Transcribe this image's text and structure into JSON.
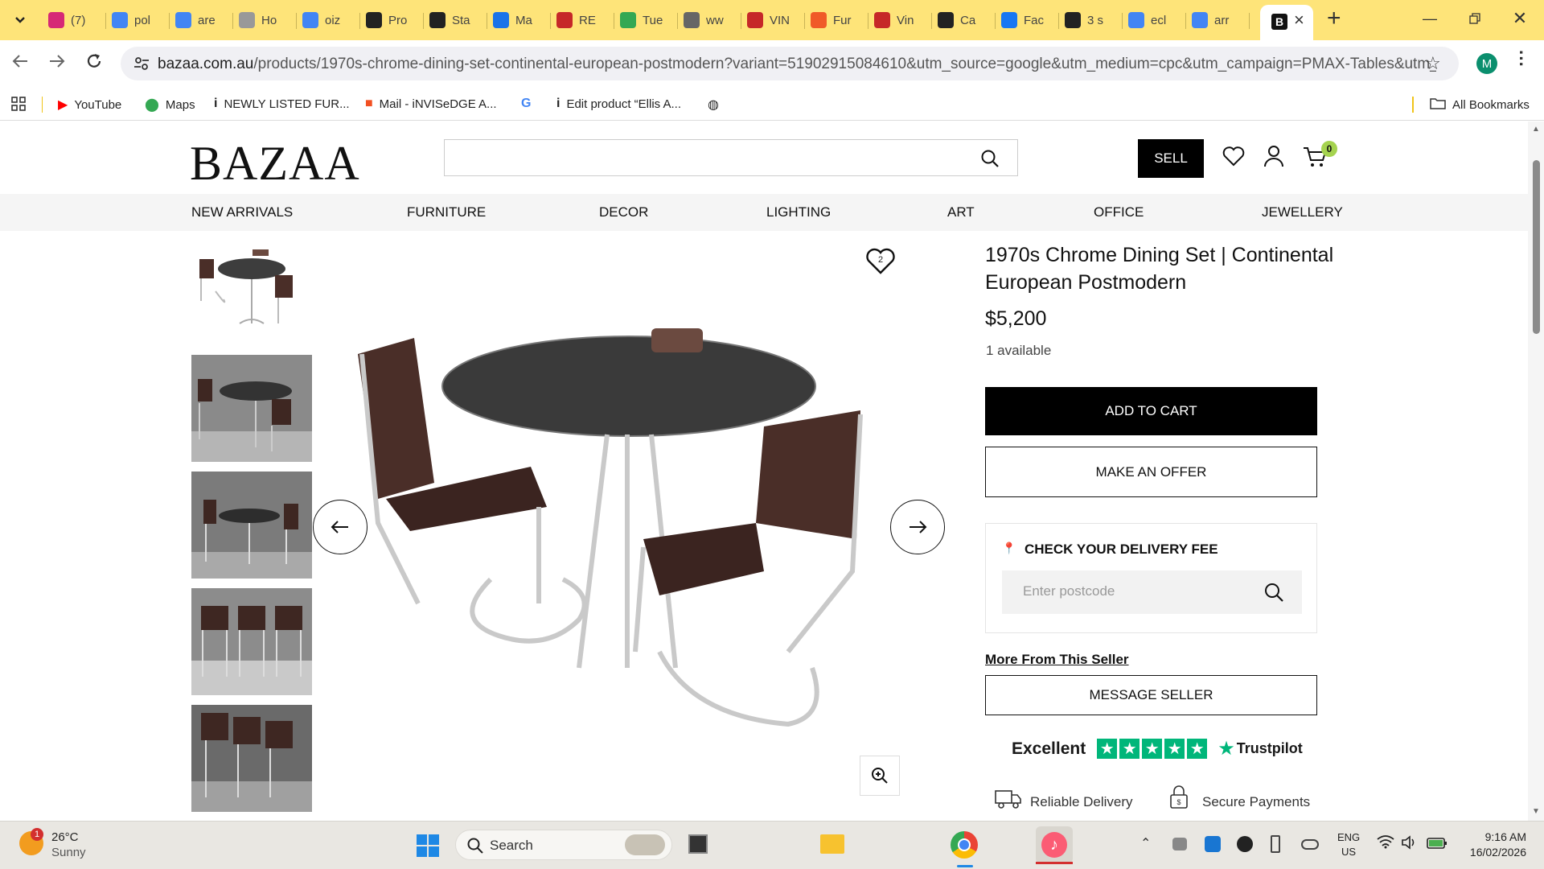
{
  "browser": {
    "tabs": [
      {
        "label": "(7)",
        "icon": "instagram-icon",
        "color": "#d62976"
      },
      {
        "label": "pol",
        "icon": "google-icon",
        "color": "#4285f4"
      },
      {
        "label": "are",
        "icon": "google-icon",
        "color": "#4285f4"
      },
      {
        "label": "Ho",
        "icon": "page-icon",
        "color": "#999999"
      },
      {
        "label": "oiz",
        "icon": "google-icon",
        "color": "#4285f4"
      },
      {
        "label": "Pro",
        "icon": "info-icon",
        "color": "#222222"
      },
      {
        "label": "Sta",
        "icon": "info-icon",
        "color": "#222222"
      },
      {
        "label": "Ma",
        "icon": "mail-icon",
        "color": "#1a73e8"
      },
      {
        "label": "RE",
        "icon": "store-icon",
        "color": "#c62828"
      },
      {
        "label": "Tue",
        "icon": "maps-icon",
        "color": "#34a853"
      },
      {
        "label": "ww",
        "icon": "globe-icon",
        "color": "#666666"
      },
      {
        "label": "VIN",
        "icon": "store-icon",
        "color": "#c62828"
      },
      {
        "label": "Fur",
        "icon": "arrow-icon",
        "color": "#f05a28"
      },
      {
        "label": "Vin",
        "icon": "store-icon",
        "color": "#c62828"
      },
      {
        "label": "Ca",
        "icon": "s-icon",
        "color": "#222222"
      },
      {
        "label": "Fac",
        "icon": "facebook-icon",
        "color": "#1877f2"
      },
      {
        "label": "3 s",
        "icon": "info-icon",
        "color": "#222222"
      },
      {
        "label": "ecl",
        "icon": "google-icon",
        "color": "#4285f4"
      },
      {
        "label": "arr",
        "icon": "google-icon",
        "color": "#4285f4"
      }
    ],
    "active_tab_icon": "B",
    "url_domain": "bazaa.com.au",
    "url_path": "/products/1970s-chrome-dining-set-continental-european-postmodern?variant=51902915084610&utm_source=google&utm_medium=cpc&utm_campaign=PMAX-Tables&utm_content...",
    "profile_initial": "M",
    "bookmarks": [
      {
        "label": "YouTube",
        "icon": "youtube-icon"
      },
      {
        "label": "Maps",
        "icon": "maps-pin-icon"
      },
      {
        "label": "NEWLY LISTED FUR...",
        "icon": "info-icon"
      },
      {
        "label": "Mail - iNVISeDGE A...",
        "icon": "microsoft-icon"
      },
      {
        "label": "",
        "icon": "google-icon"
      },
      {
        "label": "Edit product “Ellis A...",
        "icon": "info-icon"
      },
      {
        "label": "",
        "icon": "globe-icon"
      }
    ],
    "all_bookmarks": "All Bookmarks"
  },
  "site": {
    "logo": "BAZAA",
    "sell": "SELL",
    "cart_count": "0",
    "nav": [
      "NEW ARRIVALS",
      "FURNITURE",
      "DECOR",
      "LIGHTING",
      "ART",
      "OFFICE",
      "JEWELLERY"
    ]
  },
  "product": {
    "title": "1970s Chrome Dining Set | Continental European Postmodern",
    "price": "$5,200",
    "availability": "1 available",
    "wishlist_count": "2",
    "add_to_cart": "ADD TO CART",
    "make_offer": "MAKE AN OFFER",
    "delivery_heading": "CHECK YOUR DELIVERY FEE",
    "postcode_placeholder": "Enter postcode",
    "more_from_seller": "More From This Seller",
    "message_seller": "MESSAGE SELLER",
    "trustpilot_rating": "Excellent",
    "trustpilot_brand": "Trustpilot",
    "trustpilot_stars": 5,
    "features": [
      "Reliable Delivery",
      "Secure Payments"
    ]
  },
  "taskbar": {
    "weather_temp": "26°C",
    "weather_desc": "Sunny",
    "weather_badge": "1",
    "search": "Search",
    "lang_top": "ENG",
    "lang_bottom": "US",
    "time": "9:16 AM",
    "date": "16/02/2026"
  },
  "colors": {
    "tabbar": "#fee479",
    "trustpilot": "#00b67a",
    "cart_badge": "#a5d34f"
  }
}
